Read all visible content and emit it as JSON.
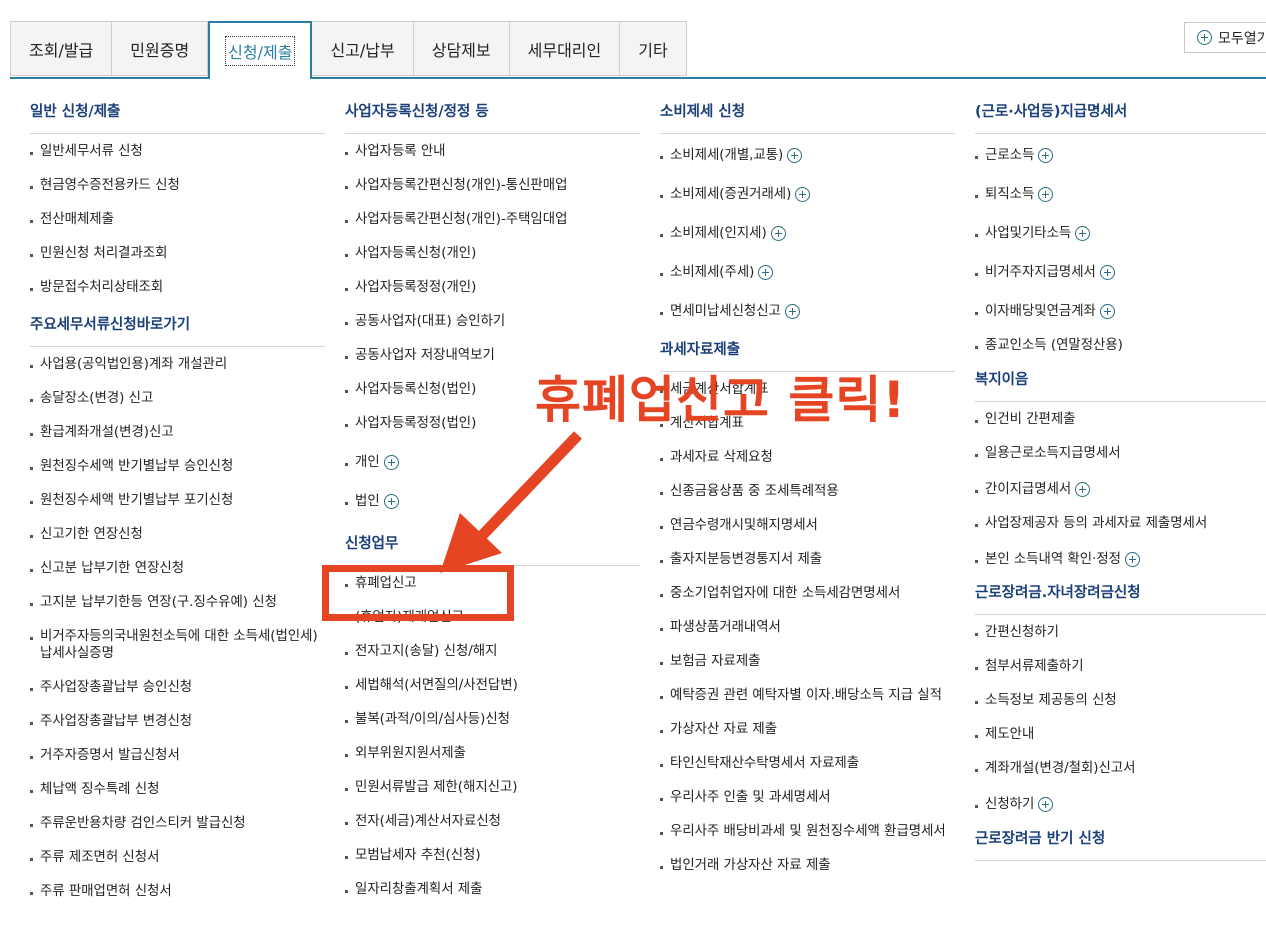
{
  "tabs": [
    "조회/발급",
    "민원증명",
    "신청/제출",
    "신고/납부",
    "상담제보",
    "세무대리인",
    "기타"
  ],
  "expand_all": "모두열기",
  "annotation": "휴폐업신고 클릭!",
  "col1": {
    "sections": [
      {
        "title": "일반 신청/제출",
        "items": [
          "일반세무서류 신청",
          "현금영수증전용카드 신청",
          "전산매체제출",
          "민원신청 처리결과조회",
          "방문접수처리상태조회"
        ]
      },
      {
        "title": "주요세무서류신청바로가기",
        "items": [
          "사업용(공익법인용)계좌 개설관리",
          "송달장소(변경) 신고",
          "환급계좌개설(변경)신고",
          "원천징수세액 반기별납부 승인신청",
          "원천징수세액 반기별납부 포기신청",
          "신고기한 연장신청",
          "신고분 납부기한 연장신청",
          "고지분 납부기한등 연장(구.징수유예) 신청",
          "비거주자등의국내원천소득에 대한 소득세(법인세) 납세사실증명",
          "주사업장총괄납부 승인신청",
          "주사업장총괄납부 변경신청",
          "거주자증명서 발급신청서",
          "체납액 징수특례 신청",
          "주류운반용차량 검인스티커 발급신청",
          "주류 제조면허 신청서",
          "주류 판매업면허 신청서"
        ]
      }
    ]
  },
  "col2": {
    "sections": [
      {
        "title": "사업자등록신청/정정 등",
        "items": [
          "사업자등록 안내",
          "사업자등록간편신청(개인)-통신판매업",
          "사업자등록간편신청(개인)-주택임대업",
          "사업자등록신청(개인)",
          "사업자등록정정(개인)",
          "공동사업자(대표) 승인하기",
          "공동사업자 저장내역보기",
          "사업자등록신청(법인)",
          "사업자등록정정(법인)",
          "개인",
          "법인"
        ]
      },
      {
        "title": "신청업무",
        "items": [
          "휴폐업신고",
          "(휴업자)재개업신고",
          "전자고지(송달) 신청/해지",
          "세법해석(서면질의/사전답변)",
          "불복(과적/이의/심사등)신청",
          "외부위원지원서제출",
          "민원서류발급 제한(해지신고)",
          "전자(세금)계산서자료신청",
          "모범납세자 추천(신청)",
          "일자리창출계획서 제출"
        ]
      }
    ]
  },
  "col3": {
    "sections": [
      {
        "title": "소비제세 신청",
        "items": [
          "소비제세(개별,교통)",
          "소비제세(증권거래세)",
          "소비제세(인지세)",
          "소비제세(주세)",
          "면세미납세신청신고"
        ]
      },
      {
        "title": "과세자료제출",
        "items": [
          "세금계산서합계표",
          "계산서합계표",
          "과세자료 삭제요청",
          "신종금융상품 중 조세특례적용",
          "연금수령개시및해지명세서",
          "출자지분등변경통지서 제출",
          "중소기업취업자에 대한 소득세감면명세서",
          "파생상품거래내역서",
          "보험금 자료제출",
          "예탁증권 관련 예탁자별 이자.배당소득 지급 실적",
          "가상자산 자료 제출",
          "타인신탁재산수탁명세서 자료제출",
          "우리사주 인출 및 과세명세서",
          "우리사주 배당비과세 및 원천징수세액 환급명세서",
          "법인거래 가상자산 자료 제출"
        ]
      }
    ]
  },
  "col4": {
    "sections": [
      {
        "title": "(근로·사업등)지급명세서",
        "items": [
          "근로소득",
          "퇴직소득",
          "사업및기타소득",
          "비거주자지급명세서",
          "이자배당및연금계좌",
          "종교인소득 (연말정산용)"
        ]
      },
      {
        "title": "복지이음",
        "items": [
          "인건비 간편제출",
          "일용근로소득지급명세서",
          "간이지급명세서",
          "사업장제공자 등의 과세자료 제출명세서",
          "본인 소득내역 확인·정정"
        ]
      },
      {
        "title": "근로장려금.자녀장려금신청",
        "items": [
          "간편신청하기",
          "첨부서류제출하기",
          "소득정보 제공동의 신청",
          "제도안내",
          "계좌개설(변경/철회)신고서",
          "신청하기"
        ]
      },
      {
        "title": "근로장려금 반기 신청",
        "items": []
      }
    ]
  }
}
